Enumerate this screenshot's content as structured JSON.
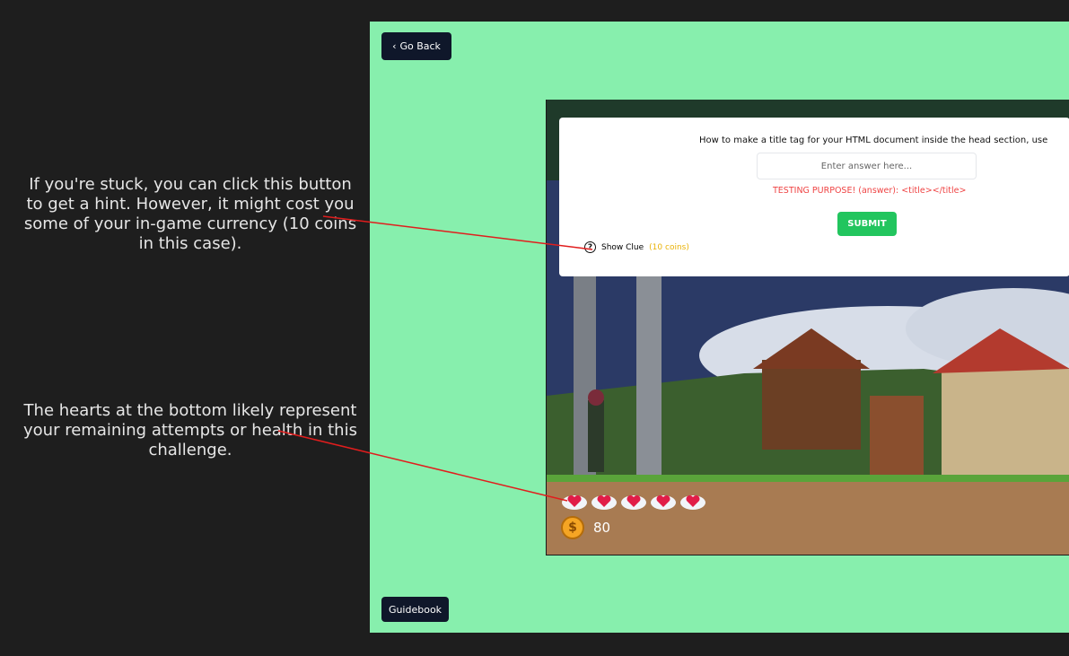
{
  "annotations": {
    "clue_hint": "If you're stuck, you can click this button to get a hint. However, it might cost you some of your in-game currency (10 coins in this case).",
    "hearts_hint": "The hearts at the bottom likely represent your remaining attempts or health in this challenge."
  },
  "nav": {
    "go_back_label": "Go Back",
    "guidebook_label": "Guidebook"
  },
  "question": {
    "text": "How to make a title tag for your HTML document inside the head section, use",
    "input_placeholder": "Enter answer here...",
    "testing_text": "TESTING PURPOSE! (answer): <title></title>",
    "submit_label": "SUBMIT",
    "clue_label": "Show Clue",
    "clue_cost": "(10 coins)"
  },
  "status": {
    "hearts": 5,
    "coins": "80"
  },
  "colors": {
    "panel": "#87efad",
    "accent": "#22c55e",
    "error": "#ef4444",
    "coin_cost": "#eab308",
    "page_bg": "#1e1e1e"
  }
}
